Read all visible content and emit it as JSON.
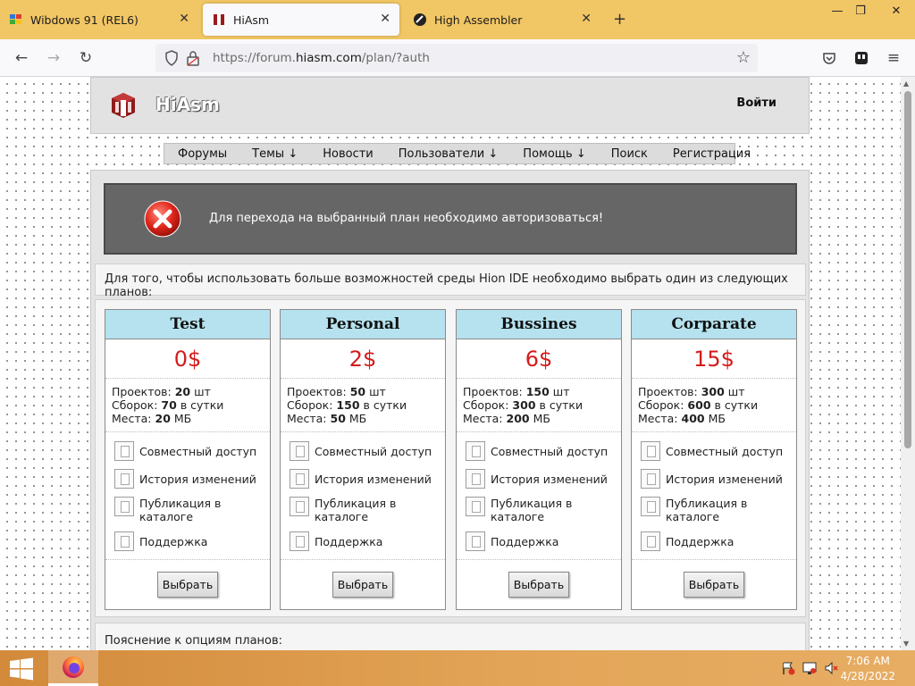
{
  "browser": {
    "tabs": [
      {
        "title": "Wibdows 91 (REL6)",
        "active": false
      },
      {
        "title": "HiAsm",
        "active": true
      },
      {
        "title": "High Assembler",
        "active": false
      }
    ],
    "url_prefix": "https://forum.",
    "url_domain": "hiasm.com",
    "url_suffix": "/plan/?auth"
  },
  "site": {
    "name": "HiAsm",
    "login": "Войти",
    "menu": [
      "Форумы",
      "Темы ↓",
      "Новости",
      "Пользователи ↓",
      "Помощь ↓",
      "Поиск",
      "Регистрация"
    ]
  },
  "alert": {
    "message": "Для перехода на выбранный план необходимо авторизоваться!"
  },
  "intro": "Для того, чтобы использовать больше возможностей среды Hion IDE необходимо выбрать один из следующих планов:",
  "stat_labels": {
    "projects": "Проектов:",
    "builds": "Сборок:",
    "space": "Места:"
  },
  "plans": [
    {
      "name": "Test",
      "price": "0$",
      "projects": "20",
      "projects_unit": "шт",
      "builds": "70",
      "builds_unit": "в сутки",
      "space": "20",
      "space_unit": "МБ"
    },
    {
      "name": "Personal",
      "price": "2$",
      "projects": "50",
      "projects_unit": "шт",
      "builds": "150",
      "builds_unit": "в сутки",
      "space": "50",
      "space_unit": "МБ"
    },
    {
      "name": "Bussines",
      "price": "6$",
      "projects": "150",
      "projects_unit": "шт",
      "builds": "300",
      "builds_unit": "в сутки",
      "space": "200",
      "space_unit": "МБ"
    },
    {
      "name": "Corparate",
      "price": "15$",
      "projects": "300",
      "projects_unit": "шт",
      "builds": "600",
      "builds_unit": "в сутки",
      "space": "400",
      "space_unit": "МБ"
    }
  ],
  "features": [
    {
      "label": "Совместный доступ"
    },
    {
      "label": "История изменений"
    },
    {
      "label": "Публикация в каталоге"
    },
    {
      "label": "Поддержка"
    }
  ],
  "choose_label": "Выбрать",
  "notes_title": "Пояснение к опциям планов:",
  "taskbar": {
    "time": "7:06 AM",
    "date": "4/28/2022"
  },
  "colors": {
    "tabbar": "#f1c664",
    "plan_header": "#b5e2ee",
    "price": "#d51b1b",
    "alert_bg": "#666666",
    "taskbar": "#e3a659"
  }
}
